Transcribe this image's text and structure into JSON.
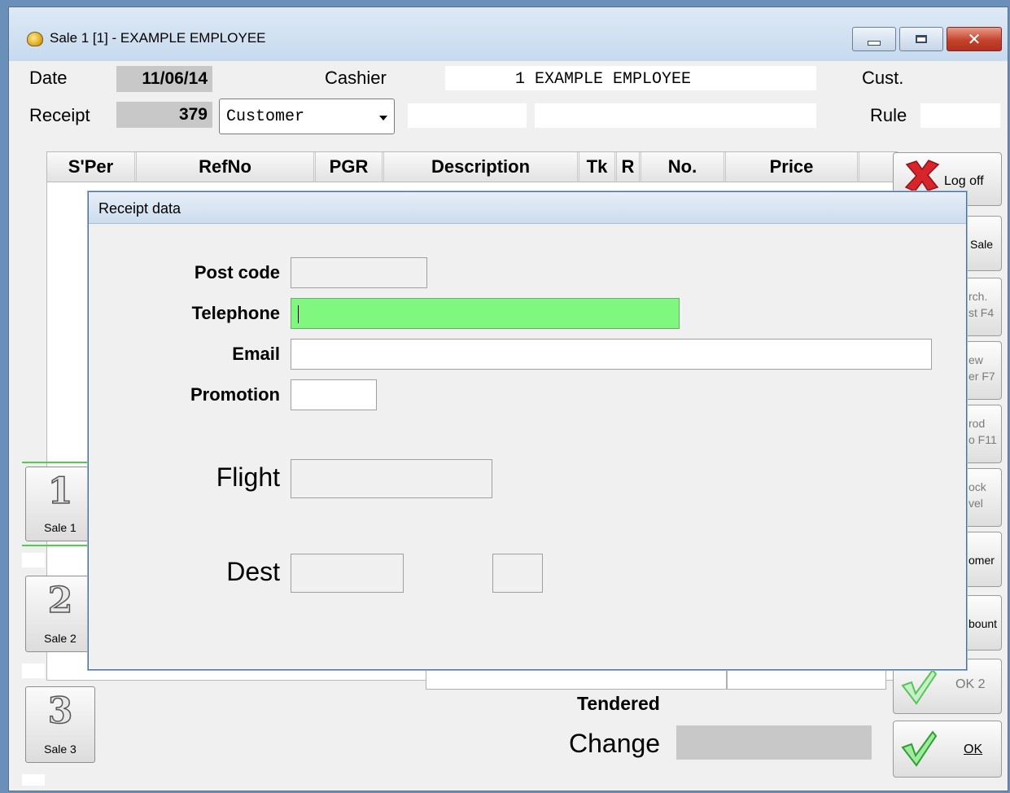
{
  "window": {
    "title": "Sale 1 [1] - EXAMPLE EMPLOYEE"
  },
  "header": {
    "date_label": "Date",
    "date_value": "11/06/14",
    "cashier_label": "Cashier",
    "cashier_value": "1 EXAMPLE EMPLOYEE",
    "cust_label": "Cust.",
    "receipt_label": "Receipt",
    "receipt_value": "379",
    "customer_select": "Customer",
    "rule_label": "Rule"
  },
  "grid": {
    "columns": [
      "S'Per",
      "RefNo",
      "PGR",
      "Description",
      "Tk",
      "R",
      "No.",
      "Price"
    ]
  },
  "side_buttons": {
    "logoff": "Log off",
    "sale": "Sale",
    "purch_line1": "rch.",
    "purch_line2": "st F4",
    "view_line1": "ew",
    "view_line2": "er F7",
    "prod_line1": "rod",
    "prod_line2": "o F11",
    "stock_line1": "ock",
    "stock_line2": "vel",
    "customer": "omer",
    "discount": "bount",
    "ok2": "OK 2",
    "ok": "OK"
  },
  "sale_tabs": [
    {
      "number": "1",
      "label": "Sale 1"
    },
    {
      "number": "2",
      "label": "Sale 2"
    },
    {
      "number": "3",
      "label": "Sale 3"
    }
  ],
  "bottom": {
    "tendered_label": "Tendered",
    "change_label": "Change"
  },
  "dialog": {
    "title": "Receipt data",
    "postcode_label": "Post code",
    "telephone_label": "Telephone",
    "email_label": "Email",
    "promotion_label": "Promotion",
    "flight_label": "Flight",
    "dest_label": "Dest"
  },
  "colors": {
    "active_field": "#80f880",
    "titlebar": "#c7daee",
    "field_gray": "#c8c8c8"
  }
}
